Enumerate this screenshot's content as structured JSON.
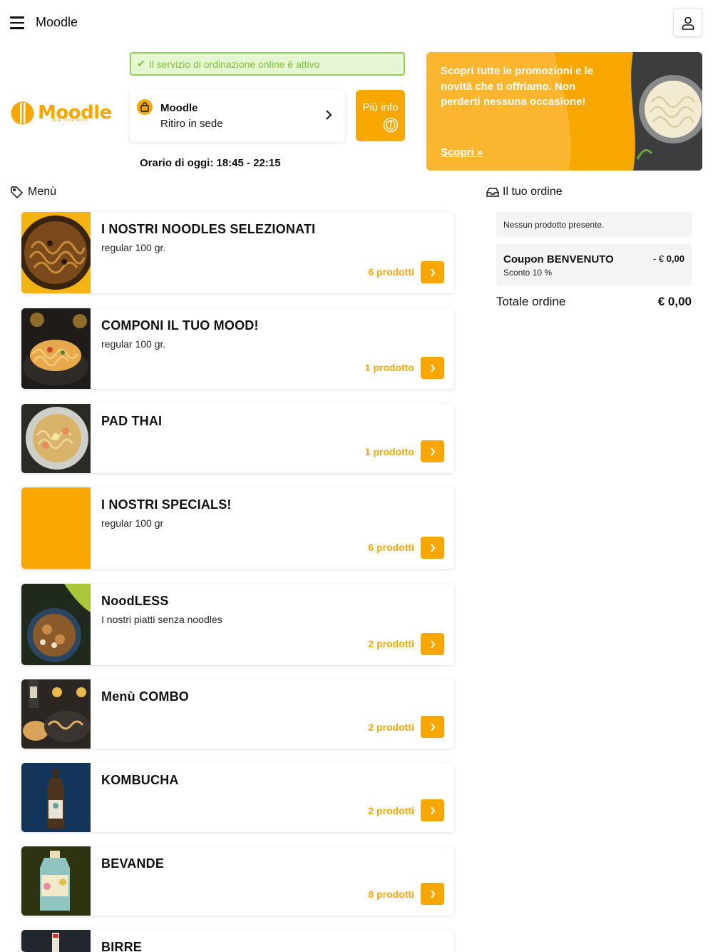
{
  "topbar": {
    "title": "Moodle"
  },
  "logo": {
    "text": "Moodle",
    "tagline": "WOK YOUR MOOD"
  },
  "status": {
    "text": "Il servizio di ordinazione online è attivo"
  },
  "store": {
    "name": "Moodle",
    "mode": "Ritiro in sede"
  },
  "info_button": {
    "label": "Più info"
  },
  "hours": {
    "text": "Orario di oggi: 18:45 - 22:15"
  },
  "promo": {
    "text": "Scopri tutte le promozioni e le novità che ti offriamo. Non perderti nessuna occasione!",
    "link": "Scopri"
  },
  "menu": {
    "heading": "Menù",
    "categories": [
      {
        "title": "I NOSTRI NOODLES SELEZIONATI",
        "desc": "regular 100 gr.",
        "count": "6 prodotti"
      },
      {
        "title": "COMPONI IL TUO MOOD!",
        "desc": "regular 100 gr.",
        "count": "1 prodotto"
      },
      {
        "title": "PAD THAI",
        "desc": "",
        "count": "1 prodotto"
      },
      {
        "title": "I NOSTRI SPECIALS!",
        "desc": "regular 100 gr",
        "count": "6 prodotti"
      },
      {
        "title": "NoodLESS",
        "desc": "I nostri piatti senza noodles",
        "count": "2 prodotti"
      },
      {
        "title": "Menù COMBO",
        "desc": "",
        "count": "2 prodotti"
      },
      {
        "title": "KOMBUCHA",
        "desc": "",
        "count": "2 prodotti"
      },
      {
        "title": "BEVANDE",
        "desc": "",
        "count": "8 prodotti"
      },
      {
        "title": "BIRRE",
        "desc": "",
        "count": ""
      }
    ]
  },
  "order": {
    "heading": "Il tuo ordine",
    "empty": "Nessun prodotto presente.",
    "coupon": {
      "name": "Coupon BENVENUTO",
      "sub": "Sconto 10 %",
      "amount_prefix": "- €",
      "amount": "0,00"
    },
    "total_label": "Totale ordine",
    "total_value": "€ 0,00"
  },
  "colors": {
    "accent": "#f7a700",
    "status_green": "#8fd14f",
    "status_bg": "#e6f6d3"
  },
  "icons": [
    "menu-icon",
    "user-icon",
    "check-icon",
    "bag-icon",
    "chevron-right-icon",
    "info-icon",
    "tag-icon",
    "inbox-icon"
  ]
}
